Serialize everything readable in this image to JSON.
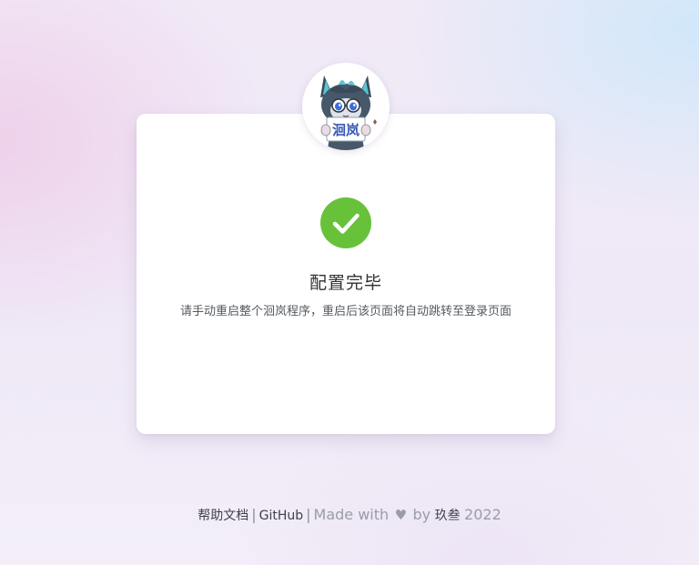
{
  "avatar": {
    "sign_text": "洄岚"
  },
  "result": {
    "icon": "check-circle-icon",
    "icon_color": "#67c23a",
    "title": "配置完毕",
    "subtitle": "请手动重启整个洄岚程序，重启后该页面将自动跳转至登录页面"
  },
  "footer": {
    "docs_link": "帮助文档",
    "separator": "|",
    "github_link": "GitHub",
    "made_with": "Made with",
    "heart": "♥",
    "by": "by",
    "author": "玖叁",
    "year": "2022"
  }
}
